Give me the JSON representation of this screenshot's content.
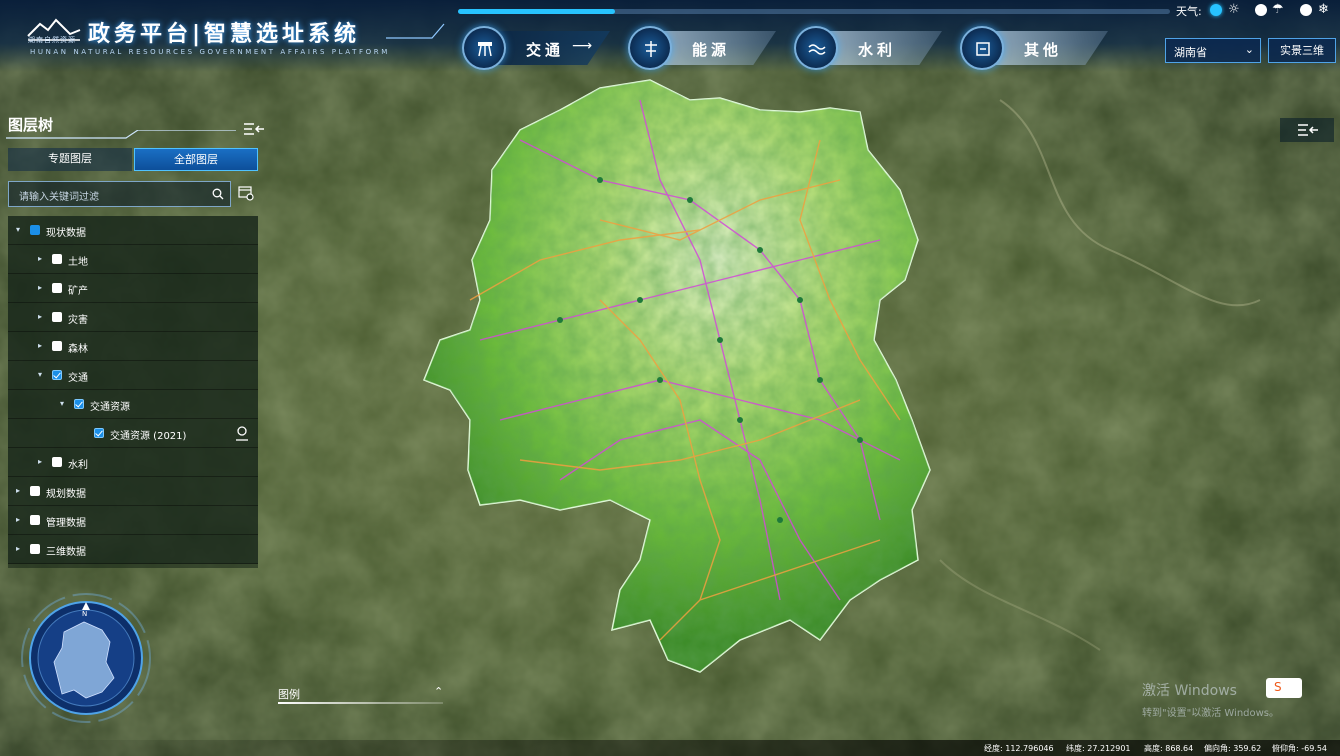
{
  "header": {
    "logo_text": "湖南自然资源",
    "title": "政务平台|智慧选址系统",
    "subtitle": "HUNAN NATURAL RESOURCES GOVERNMENT AFFAIRS PLATFORM",
    "progress": 0.22,
    "tabs": [
      {
        "label": "交通",
        "icon": "traffic-icon",
        "active": true
      },
      {
        "label": "能源",
        "icon": "energy-icon",
        "active": false
      },
      {
        "label": "水利",
        "icon": "water-icon",
        "active": false
      },
      {
        "label": "其他",
        "icon": "other-icon",
        "active": false
      }
    ],
    "weather_label": "天气:",
    "weather_icons": [
      "sun-icon",
      "cloud-icon",
      "rain-icon",
      "snow-icon"
    ],
    "region_select": "湖南省",
    "btn_3d": "实景三维"
  },
  "layer_panel": {
    "title": "图层树",
    "seg_thematic": "专题图层",
    "seg_all": "全部图层",
    "search_placeholder": "请输入关键词过滤",
    "tree": [
      {
        "label": "现状数据",
        "level": 0,
        "state": "partial",
        "expanded": true
      },
      {
        "label": "土地",
        "level": 1,
        "state": "off"
      },
      {
        "label": "矿产",
        "level": 1,
        "state": "off"
      },
      {
        "label": "灾害",
        "level": 1,
        "state": "off"
      },
      {
        "label": "森林",
        "level": 1,
        "state": "off"
      },
      {
        "label": "交通",
        "level": 1,
        "state": "on",
        "expanded": true
      },
      {
        "label": "交通资源",
        "level": 2,
        "state": "on",
        "expanded": true
      },
      {
        "label": "交通资源 (2021)",
        "level": 3,
        "state": "on"
      },
      {
        "label": "水利",
        "level": 1,
        "state": "off"
      },
      {
        "label": "规划数据",
        "level": 0,
        "state": "off"
      },
      {
        "label": "管理数据",
        "level": 0,
        "state": "off"
      },
      {
        "label": "三维数据",
        "level": 0,
        "state": "off"
      }
    ]
  },
  "compass": {
    "north": "N"
  },
  "legend": {
    "title": "图例"
  },
  "watermark": {
    "line1": "激活 Windows",
    "line2": "转到\"设置\"以激活 Windows。"
  },
  "status": {
    "lon": "经度: 112.796046",
    "lat": "纬度: 27.212901",
    "alt": "高度: 868.64",
    "heading": "偏向角: 359.62",
    "pitch": "俯仰角: -69.54"
  },
  "colors": {
    "accent": "#27c3ff",
    "panel_btn": "#1a6fc4",
    "road_pink": "#d24bd8",
    "road_orange": "#f0a040"
  }
}
